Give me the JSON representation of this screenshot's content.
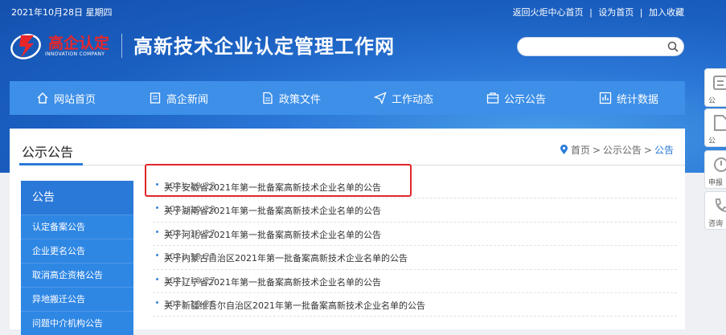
{
  "topbar": {
    "date": "2021年10月28日 星期四",
    "links": [
      "返回火炬中心首页",
      "设为首页",
      "加入收藏"
    ],
    "separator": "|"
  },
  "logo": {
    "text": "高企认定",
    "subtext": "INNOVATION COMPANY"
  },
  "site_title": "高新技术企业认定管理工作网",
  "search": {
    "placeholder": ""
  },
  "nav": [
    {
      "label": "网站首页",
      "icon": "home-icon"
    },
    {
      "label": "高企新闻",
      "icon": "news-icon"
    },
    {
      "label": "政策文件",
      "icon": "document-icon"
    },
    {
      "label": "工作动态",
      "icon": "send-icon"
    },
    {
      "label": "公示公告",
      "icon": "bulletin-icon"
    },
    {
      "label": "统计数据",
      "icon": "chart-icon"
    }
  ],
  "section": {
    "title": "公示公告",
    "breadcrumb": [
      "首页",
      ">",
      "公示公告",
      ">",
      "公告"
    ]
  },
  "sidebar": {
    "header": "公告",
    "items": [
      "认定备案公告",
      "企业更名公告",
      "取消高企资格公告",
      "异地搬迁公告",
      "问题中介机构公告"
    ]
  },
  "announcements": [
    {
      "title": "关于安徽省2021年第一批备案高新技术企业名单的公告",
      "date": "2021-10-28"
    },
    {
      "title": "关于湖南省2021年第一批备案高新技术企业名单的公告",
      "date": "2021-10-28"
    },
    {
      "title": "关于河北省2021年第一批备案高新技术企业名单的公告",
      "date": "2021-10-27"
    },
    {
      "title": "关于内蒙古自治区2021年第一批备案高新技术企业名单的公告",
      "date": "2021-10-27"
    },
    {
      "title": "关于辽宁省2021年第一批备案高新技术企业名单的公告",
      "date": "2021-10-27"
    },
    {
      "title": "关于新疆维吾尔自治区2021年第一批备案高新技术企业名单的公告",
      "date": "2021-10-26"
    }
  ],
  "float_bar": [
    {
      "label": "公",
      "icon": "notice-icon"
    },
    {
      "label": "公",
      "icon": "doc-icon"
    },
    {
      "label": "申报",
      "icon": "apply-icon"
    },
    {
      "label": "咨询",
      "icon": "phone-icon"
    }
  ],
  "colors": {
    "accent": "#2a7ad8",
    "nav": "#3d8fe8",
    "highlight": "#e0262a"
  }
}
